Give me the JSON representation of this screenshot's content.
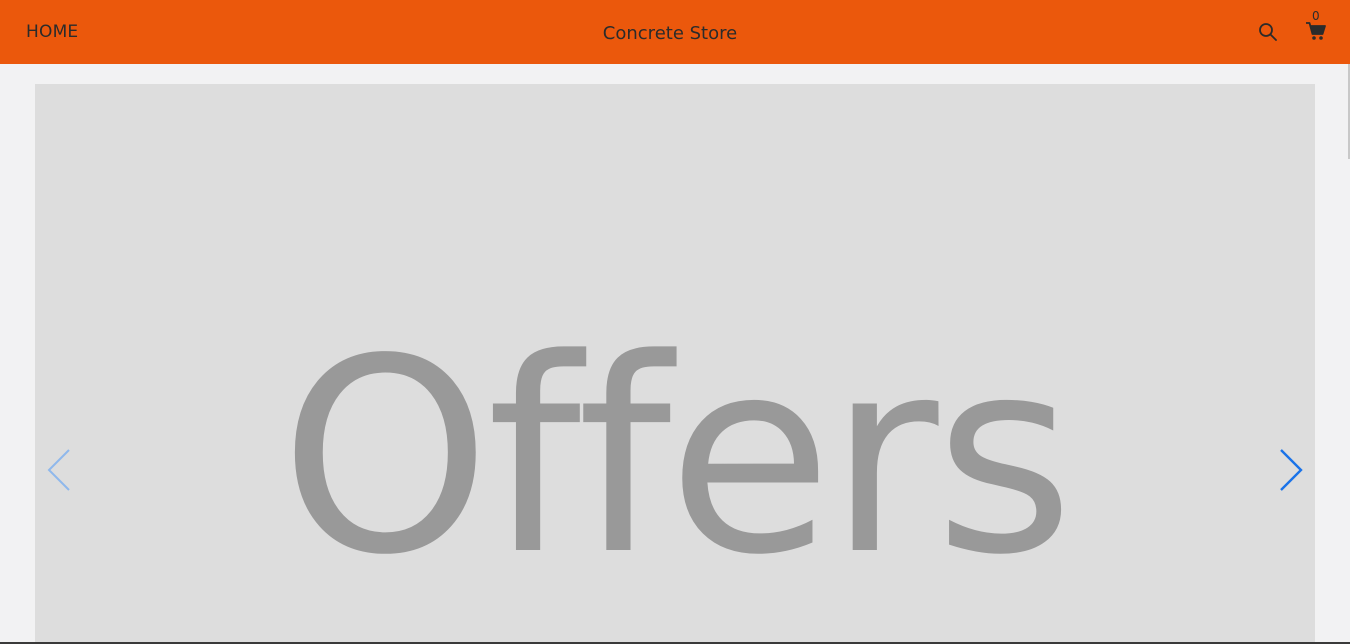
{
  "header": {
    "home_label": "HOME",
    "store_title": "Concrete Store",
    "cart_count": "0",
    "background_color": "#eb580c"
  },
  "icons": {
    "search": "search-icon",
    "cart": "cart-icon",
    "prev": "chevron-left-icon",
    "next": "chevron-right-icon"
  },
  "carousel": {
    "slide_text": "Offers",
    "arrow_color": "#1a73e8"
  }
}
